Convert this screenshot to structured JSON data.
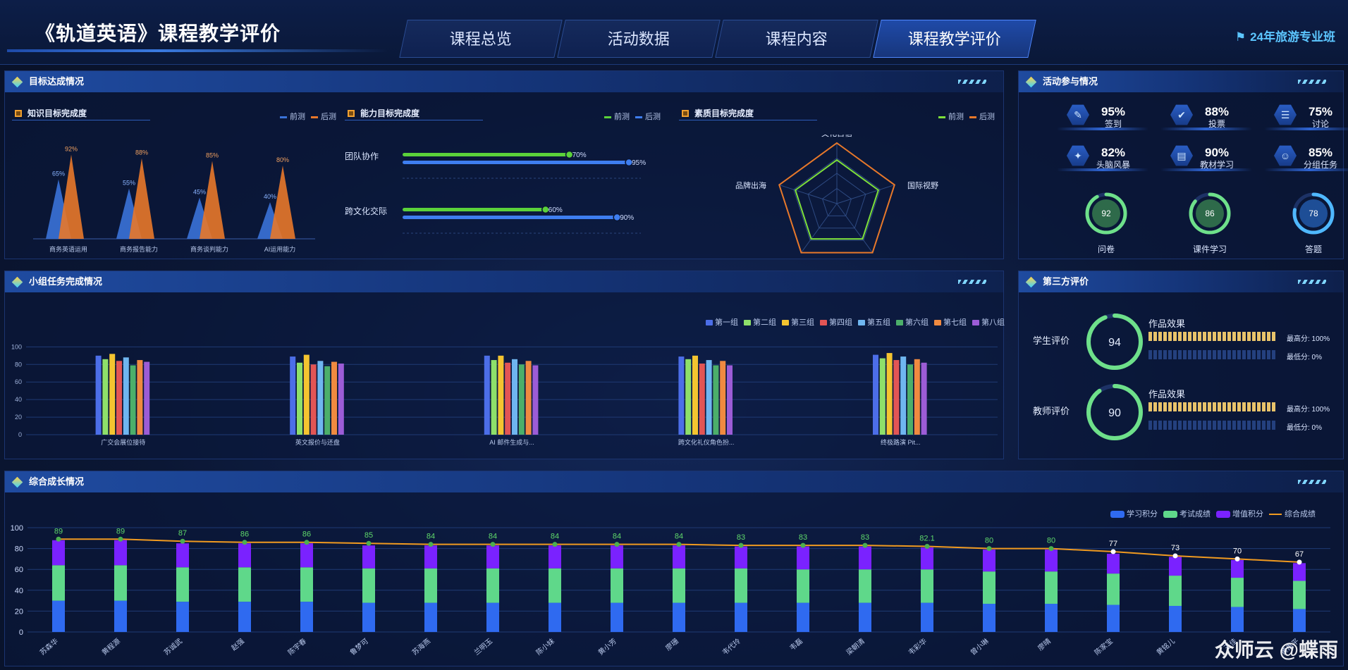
{
  "header": {
    "title": "《轨道英语》课程教学评价",
    "class_label": "24年旅游专业班",
    "tabs": [
      {
        "label": "课程总览",
        "active": false
      },
      {
        "label": "活动数据",
        "active": false
      },
      {
        "label": "课程内容",
        "active": false
      },
      {
        "label": "课程教学评价",
        "active": true
      }
    ]
  },
  "panels": {
    "goal": "目标达成情况",
    "activity": "活动参与情况",
    "group": "小组任务完成情况",
    "third": "第三方评价",
    "growth": "综合成长情况"
  },
  "knowledge": {
    "title": "知识目标完成度",
    "legend": [
      "前测",
      "后测"
    ],
    "colors": [
      "#3a72d8",
      "#e8782a"
    ],
    "chart_data": {
      "type": "bar",
      "categories": [
        "商务英语运用",
        "商务报告能力",
        "商务谈判能力",
        "AI运用能力"
      ],
      "series": [
        {
          "name": "前测",
          "values": [
            65,
            55,
            45,
            40
          ]
        },
        {
          "name": "后测",
          "values": [
            92,
            88,
            85,
            80
          ]
        }
      ],
      "ylim": [
        0,
        100
      ]
    }
  },
  "ability": {
    "title": "能力目标完成度",
    "legend": [
      "前测",
      "后测"
    ],
    "colors": [
      "#5bd23a",
      "#3e7ef0"
    ],
    "chart_data": {
      "type": "bar",
      "categories": [
        "团队协作",
        "跨文化交际"
      ],
      "series": [
        {
          "name": "前测",
          "values": [
            70,
            60
          ]
        },
        {
          "name": "后测",
          "values": [
            95,
            90
          ]
        }
      ],
      "xlim": [
        0,
        100
      ]
    }
  },
  "quality": {
    "title": "素质目标完成度",
    "legend": [
      "前测",
      "后测"
    ],
    "colors": [
      "#7ee03a",
      "#e8782a"
    ],
    "chart_data": {
      "type": "radar",
      "indicators": [
        "文化自信",
        "国际视野",
        "",
        "",
        "品牌出海"
      ]
    }
  },
  "activity": {
    "stats": [
      {
        "icon": "sign-in-icon",
        "value": "95%",
        "label": "签到"
      },
      {
        "icon": "vote-icon",
        "value": "88%",
        "label": "投票"
      },
      {
        "icon": "discuss-icon",
        "value": "75%",
        "label": "讨论"
      },
      {
        "icon": "brainstorm-icon",
        "value": "82%",
        "label": "头脑风暴"
      },
      {
        "icon": "textbook-icon",
        "value": "90%",
        "label": "教材学习"
      },
      {
        "icon": "group-task-icon",
        "value": "85%",
        "label": "分组任务"
      }
    ],
    "rings": [
      {
        "value": "92",
        "label": "问卷",
        "color": "#6ee08a"
      },
      {
        "value": "86",
        "label": "课件学习",
        "color": "#6ee08a"
      },
      {
        "value": "78",
        "label": "答题",
        "color": "#4fb8ff"
      }
    ]
  },
  "group": {
    "legend": [
      "第一组",
      "第二组",
      "第三组",
      "第四组",
      "第五组",
      "第六组",
      "第七组",
      "第八组"
    ],
    "colors": [
      "#4c6ee8",
      "#8ee06a",
      "#f4c430",
      "#e25555",
      "#6fb6f0",
      "#4caf6a",
      "#f08a40",
      "#9c5cd6"
    ],
    "chart_data": {
      "type": "bar",
      "categories": [
        "广交会展位接待",
        "英文报价与还盘",
        "AI 邮件生成与...",
        "跨文化礼仪角色扮...",
        "终极路演 Pit..."
      ],
      "ylim": [
        0,
        100
      ],
      "yticks": [
        0,
        20,
        40,
        60,
        80,
        100
      ],
      "series": [
        {
          "name": "第一组",
          "values": [
            90,
            89,
            90,
            89,
            91
          ]
        },
        {
          "name": "第二组",
          "values": [
            86,
            82,
            85,
            86,
            87
          ]
        },
        {
          "name": "第三组",
          "values": [
            92,
            91,
            90,
            90,
            93
          ]
        },
        {
          "name": "第四组",
          "values": [
            84,
            80,
            82,
            81,
            85
          ]
        },
        {
          "name": "第五组",
          "values": [
            88,
            84,
            86,
            85,
            89
          ]
        },
        {
          "name": "第六组",
          "values": [
            79,
            78,
            80,
            79,
            80
          ]
        },
        {
          "name": "第七组",
          "values": [
            85,
            83,
            84,
            84,
            86
          ]
        },
        {
          "name": "第八组",
          "values": [
            83,
            81,
            79,
            79,
            82
          ]
        }
      ]
    }
  },
  "third": {
    "items": [
      {
        "label": "学生评价",
        "score": "94",
        "title": "作品效果",
        "max": "最高分: 100%",
        "min": "最低分: 0%"
      },
      {
        "label": "教师评价",
        "score": "90",
        "title": "作品效果",
        "max": "最高分: 100%",
        "min": "最低分: 0%"
      }
    ]
  },
  "growth": {
    "legend": [
      "学习积分",
      "考试成绩",
      "增值积分",
      "综合成绩"
    ],
    "colors": [
      "#2f6af0",
      "#5fd88a",
      "#7a22ff",
      "#f09a20"
    ],
    "chart_data": {
      "type": "bar",
      "categories": [
        "苏森华",
        "黄程源",
        "苏诚武",
        "赵强",
        "陈宇春",
        "鲁梦可",
        "苏海燕",
        "兰明玉",
        "陈小妹",
        "黄小芳",
        "廖珊",
        "韦代玲",
        "韦磊",
        "梁朝清",
        "韦彩华",
        "曾小琳",
        "廖晴",
        "陈家宝",
        "黄铭儿",
        "王佳",
        "黄禹平"
      ],
      "ylim": [
        0,
        100
      ],
      "yticks": [
        0,
        20,
        40,
        60,
        80,
        100
      ],
      "series": [
        {
          "name": "学习积分",
          "values": [
            30,
            30,
            29,
            29,
            29,
            28,
            28,
            28,
            28,
            28,
            28,
            28,
            28,
            28,
            28,
            27,
            27,
            26,
            25,
            24,
            22
          ]
        },
        {
          "name": "考试成绩",
          "values": [
            34,
            34,
            33,
            33,
            33,
            33,
            33,
            33,
            33,
            33,
            33,
            33,
            32,
            32,
            32,
            31,
            31,
            30,
            29,
            28,
            27
          ]
        },
        {
          "name": "增值积分",
          "values": [
            24,
            24,
            23,
            23,
            23,
            22,
            22,
            22,
            22,
            22,
            22,
            21,
            22,
            22,
            21,
            21,
            21,
            19,
            18,
            17,
            17
          ]
        },
        {
          "name": "综合成绩",
          "values": [
            89,
            89,
            87,
            86,
            86,
            85,
            84,
            84,
            84,
            84,
            84,
            83,
            83,
            83,
            82.1,
            80,
            80,
            77,
            73,
            70,
            67
          ]
        }
      ]
    }
  },
  "watermark": "众师云 @蝶雨"
}
